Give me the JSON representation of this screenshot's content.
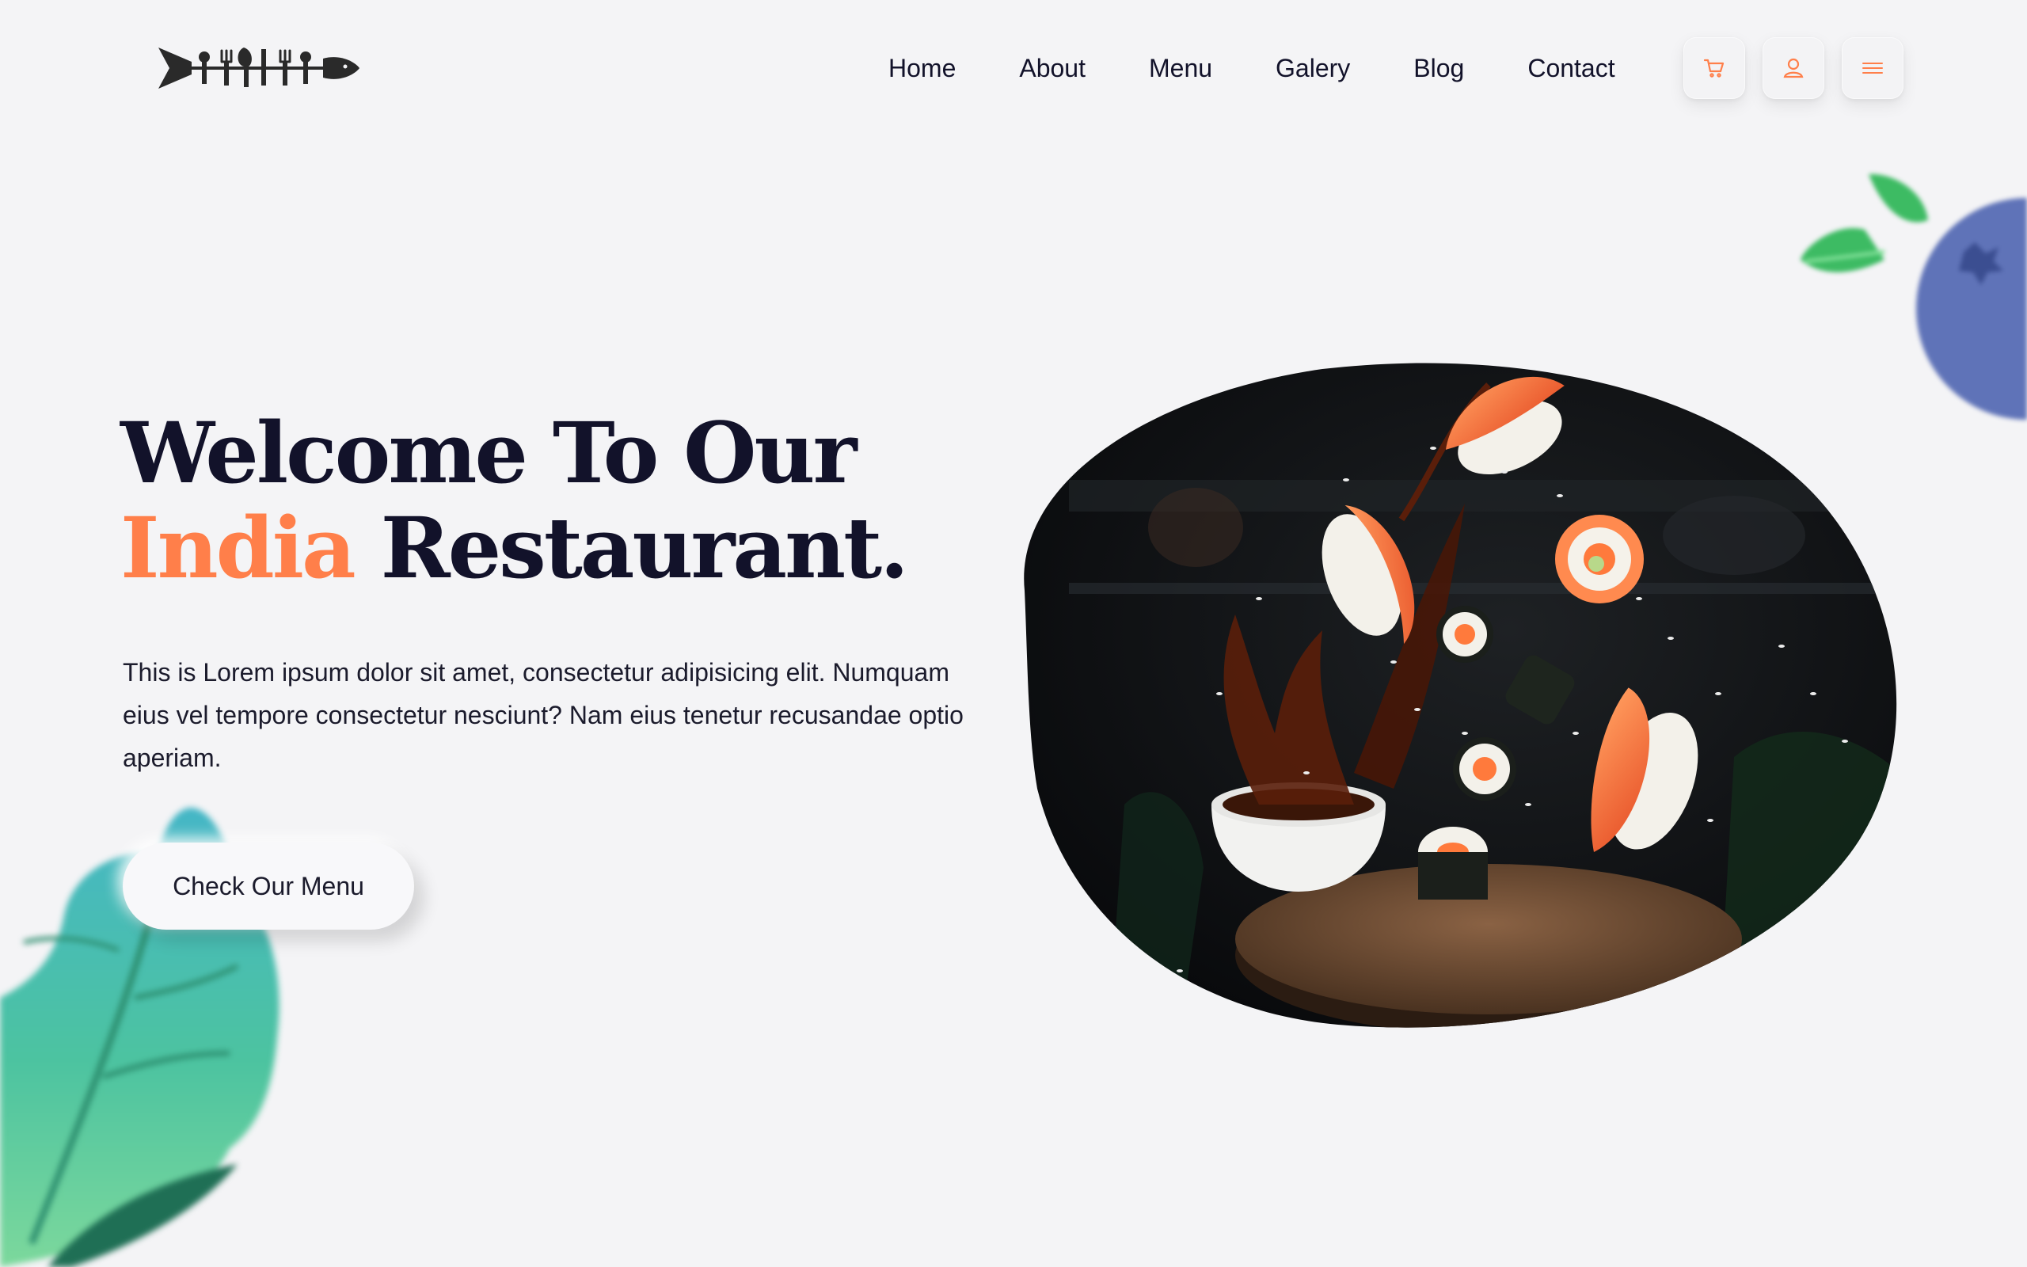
{
  "header": {
    "logo_name": "cutlery-fish-logo",
    "nav": [
      {
        "label": "Home"
      },
      {
        "label": "About"
      },
      {
        "label": "Menu"
      },
      {
        "label": "Galery"
      },
      {
        "label": "Blog"
      },
      {
        "label": "Contact"
      }
    ],
    "icons": [
      "cart-icon",
      "user-icon",
      "hamburger-menu-icon"
    ]
  },
  "hero": {
    "title_line1": "Welcome To Our",
    "title_accent": "India",
    "title_rest": "Restaurant.",
    "description": "This is Lorem ipsum dolor sit amet, consectetur adipisicing elit. Numquam eius vel tempore consectetur nesciunt? Nam eius tenetur recusandae optio aperiam.",
    "cta_label": "Check Our Menu",
    "image": "flying-sushi-photo"
  },
  "colors": {
    "accent": "#ff7f4a",
    "text_dark": "#12122a",
    "background": "#f4f4f6",
    "blueberry": "#5f73b8",
    "leaf_green": "#3cc56a"
  }
}
